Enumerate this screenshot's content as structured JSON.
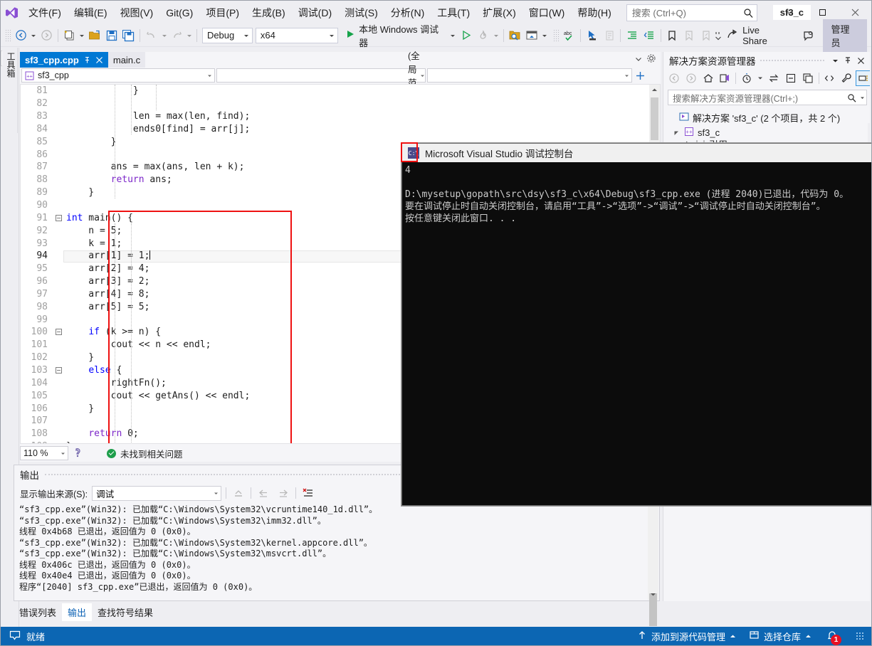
{
  "titlebar": {
    "logo_icon": "visual-studio-logo",
    "menus": [
      {
        "label": "文件(F)"
      },
      {
        "label": "编辑(E)"
      },
      {
        "label": "视图(V)"
      },
      {
        "label": "Git(G)"
      },
      {
        "label": "项目(P)"
      },
      {
        "label": "生成(B)"
      },
      {
        "label": "调试(D)"
      },
      {
        "label": "测试(S)"
      },
      {
        "label": "分析(N)"
      },
      {
        "label": "工具(T)"
      },
      {
        "label": "扩展(X)"
      },
      {
        "label": "窗口(W)"
      },
      {
        "label": "帮助(H)"
      }
    ],
    "search": {
      "placeholder": "搜索 (Ctrl+Q)",
      "value": "",
      "icon": "search-icon"
    },
    "project_chip": "sf3_c",
    "window_controls": {
      "minimize": "—",
      "maximize": "□",
      "close": "✕"
    }
  },
  "toolbar": {
    "nav_back_icon": "navigate-back-icon",
    "nav_forward_icon": "navigate-forward-icon",
    "new_item_icon": "new-item-icon",
    "open_file_icon": "open-file-icon",
    "save_icon": "save-icon",
    "save_all_icon": "save-all-icon",
    "undo_icon": "undo-icon",
    "redo_icon": "redo-icon",
    "config_combo": "Debug",
    "platform_combo": "x64",
    "run_label": "本地 Windows 调试器",
    "run_icon": "play-icon",
    "start_no_debug_icon": "start-without-debugging-icon",
    "hot_reload_icon": "hot-reload-icon",
    "find_in_files_icon": "find-in-files-icon",
    "window_layout_icon": "window-layout-icon",
    "spellcheck_icon": "spell-check-icon",
    "select_icon": "pointer-select-icon",
    "comment_icon": "comment-selection-icon",
    "indent_icon": "increase-indent-icon",
    "outdent_icon": "decrease-indent-icon",
    "bookmark_icon": "toggle-bookmark-icon",
    "prev_bookmark_icon": "previous-bookmark-icon",
    "next_bookmark_icon": "next-bookmark-icon",
    "live_share_label": "Live Share",
    "live_share_icon": "live-share-icon",
    "feedback_icon": "send-feedback-icon",
    "admin_label": "管理员"
  },
  "toolbox_tab": {
    "label": "工具箱"
  },
  "editor": {
    "tabs": [
      {
        "label": "sf3_cpp.cpp",
        "active": true,
        "pin_icon": "pin-icon",
        "close_icon": "close-icon"
      },
      {
        "label": "main.c",
        "active": false
      }
    ],
    "tab_overflow_icon": "chevron-down-icon",
    "tab_settings_icon": "gear-icon",
    "project_combo": "sf3_cpp",
    "project_combo_icon": "cpp-project-icon",
    "scope_combo": "(全局范围)",
    "member_combo": "",
    "split_icon": "split-window-icon",
    "zoom_level": "110 %",
    "analysis_icon": "code-analysis-icon",
    "issue_status": "未找到相关问题",
    "issue_status_icon": "ok-check-icon",
    "lines": [
      {
        "num": 81,
        "indent": 12,
        "text": "}",
        "fold": "",
        "guides": 1
      },
      {
        "num": 82,
        "indent": 0,
        "text": "",
        "fold": "",
        "guides": 1
      },
      {
        "num": 83,
        "indent": 12,
        "text": "len = max(len, find);",
        "fold": "",
        "guides": 2
      },
      {
        "num": 84,
        "indent": 12,
        "text": "ends0[find] = arr[j];",
        "fold": "",
        "guides": 2
      },
      {
        "num": 85,
        "indent": 8,
        "text": "}",
        "fold": "",
        "guides": 1
      },
      {
        "num": 86,
        "indent": 0,
        "text": "",
        "fold": "",
        "guides": 1
      },
      {
        "num": 87,
        "indent": 8,
        "text": "ans = max(ans, len + k);",
        "fold": "",
        "guides": 1
      },
      {
        "num": 88,
        "indent": 8,
        "text": "return ans;",
        "fold": "",
        "guides": 1
      },
      {
        "num": 89,
        "indent": 4,
        "text": "}",
        "fold": "",
        "guides": 0
      },
      {
        "num": 90,
        "indent": 0,
        "text": "",
        "fold": "",
        "guides": 0
      },
      {
        "num": 91,
        "indent": 0,
        "text": "int main() {",
        "fold": "minus",
        "guides": 0
      },
      {
        "num": 92,
        "indent": 4,
        "text": "n = 5;",
        "fold": "",
        "guides": 1
      },
      {
        "num": 93,
        "indent": 4,
        "text": "k = 1;",
        "fold": "",
        "guides": 1
      },
      {
        "num": 94,
        "indent": 4,
        "text": "arr[1] = 1;",
        "fold": "",
        "guides": 1,
        "current": true
      },
      {
        "num": 95,
        "indent": 4,
        "text": "arr[2] = 4;",
        "fold": "",
        "guides": 1
      },
      {
        "num": 96,
        "indent": 4,
        "text": "arr[3] = 2;",
        "fold": "",
        "guides": 1
      },
      {
        "num": 97,
        "indent": 4,
        "text": "arr[4] = 8;",
        "fold": "",
        "guides": 1
      },
      {
        "num": 98,
        "indent": 4,
        "text": "arr[5] = 5;",
        "fold": "",
        "guides": 1
      },
      {
        "num": 99,
        "indent": 0,
        "text": "",
        "fold": "",
        "guides": 1
      },
      {
        "num": 100,
        "indent": 4,
        "text": "if (k >= n) {",
        "fold": "minus",
        "guides": 1
      },
      {
        "num": 101,
        "indent": 8,
        "text": "cout << n << endl;",
        "fold": "",
        "guides": 2
      },
      {
        "num": 102,
        "indent": 4,
        "text": "}",
        "fold": "",
        "guides": 1
      },
      {
        "num": 103,
        "indent": 4,
        "text": "else {",
        "fold": "minus",
        "guides": 1
      },
      {
        "num": 104,
        "indent": 8,
        "text": "rightFn();",
        "fold": "",
        "guides": 2
      },
      {
        "num": 105,
        "indent": 8,
        "text": "cout << getAns() << endl;",
        "fold": "",
        "guides": 2
      },
      {
        "num": 106,
        "indent": 4,
        "text": "}",
        "fold": "",
        "guides": 1
      },
      {
        "num": 107,
        "indent": 0,
        "text": "",
        "fold": "",
        "guides": 1
      },
      {
        "num": 108,
        "indent": 4,
        "text": "return 0;",
        "fold": "",
        "guides": 1
      },
      {
        "num": 109,
        "indent": 0,
        "text": "}",
        "fold": "",
        "guides": 0
      }
    ]
  },
  "output": {
    "title": "输出",
    "source_label": "显示输出来源(S):",
    "source_value": "调试",
    "clear_icon": "clear-output-icon",
    "nav_prev_icon": "go-to-previous-icon",
    "nav_next_icon": "go-to-next-icon",
    "wordwrap_icon": "toggle-word-wrap-icon",
    "lines": [
      "“sf3_cpp.exe”(Win32): 已加载“C:\\Windows\\System32\\vcruntime140_1d.dll”。",
      "“sf3_cpp.exe”(Win32): 已加载“C:\\Windows\\System32\\imm32.dll”。",
      "线程 0x4b68 已退出，返回值为 0 (0x0)。",
      "“sf3_cpp.exe”(Win32): 已加载“C:\\Windows\\System32\\kernel.appcore.dll”。",
      "“sf3_cpp.exe”(Win32): 已加载“C:\\Windows\\System32\\msvcrt.dll”。",
      "线程 0x406c 已退出，返回值为 0 (0x0)。",
      "线程 0x40e4 已退出，返回值为 0 (0x0)。",
      "程序“[2040] sf3_cpp.exe”已退出，返回值为 0 (0x0)。"
    ]
  },
  "bottom_tabs": [
    {
      "label": "错误列表",
      "active": false
    },
    {
      "label": "输出",
      "active": true
    },
    {
      "label": "查找符号结果",
      "active": false
    }
  ],
  "statusbar": {
    "ready_label": "就绪",
    "ready_icon": "status-ready-icon",
    "source_control_label": "添加到源代码管理",
    "source_control_icon": "up-arrow-icon",
    "repo_label": "选择仓库",
    "repo_icon": "repository-icon",
    "notifications_icon": "bell-icon",
    "notifications_count": "1"
  },
  "solution_explorer": {
    "title": "解决方案资源管理器",
    "dropdown_icon": "chevron-down-icon",
    "pin_icon": "pin-icon",
    "close_icon": "close-icon",
    "toolbar": {
      "back_icon": "navigate-back-icon",
      "forward_icon": "navigate-forward-icon",
      "home_icon": "home-icon",
      "sync_icon": "sync-with-active-document-icon",
      "pending_changes_icon": "pending-changes-filter-icon",
      "refresh_icon": "refresh-icon",
      "collapse_all_icon": "collapse-all-icon",
      "show_all_files_icon": "show-all-files-icon",
      "code_view_icon": "view-code-icon",
      "properties_icon": "properties-wrench-icon",
      "preview_icon": "preview-selected-items-icon"
    },
    "search_placeholder": "搜索解决方案资源管理器(Ctrl+;)",
    "search_icon": "search-icon",
    "search_dropdown_icon": "chevron-down-icon",
    "tree": [
      {
        "label": "解决方案 'sf3_c' (2 个项目，共 2 个)",
        "icon": "solution-icon",
        "depth": 0,
        "expander": ""
      },
      {
        "label": "sf3_c",
        "icon": "cpp-project-icon",
        "depth": 1,
        "expander": "expanded"
      },
      {
        "label": "引用",
        "icon": "references-icon",
        "depth": 2,
        "expander": "collapsed"
      }
    ]
  },
  "console_window": {
    "title": "Microsoft Visual Studio 调试控制台",
    "icon": "console-icon",
    "output_value": "4",
    "lines": [
      "4",
      "",
      "D:\\mysetup\\gopath\\src\\dsy\\sf3_c\\x64\\Debug\\sf3_cpp.exe (进程 2040)已退出，代码为 0。",
      "要在调试停止时自动关闭控制台，请启用“工具”->“选项”->“调试”->“调试停止时自动关闭控制台”。",
      "按任意键关闭此窗口. . ."
    ]
  },
  "colors": {
    "accent": "#0c66b3",
    "tab_active": "#0078d4",
    "chrome": "#eeeef2",
    "editor_bg": "#ffffff",
    "console_bg": "#0c0c0c",
    "highlight_red": "#ee1111",
    "badge_red": "#e81123",
    "ok_green": "#1d9e4b"
  }
}
